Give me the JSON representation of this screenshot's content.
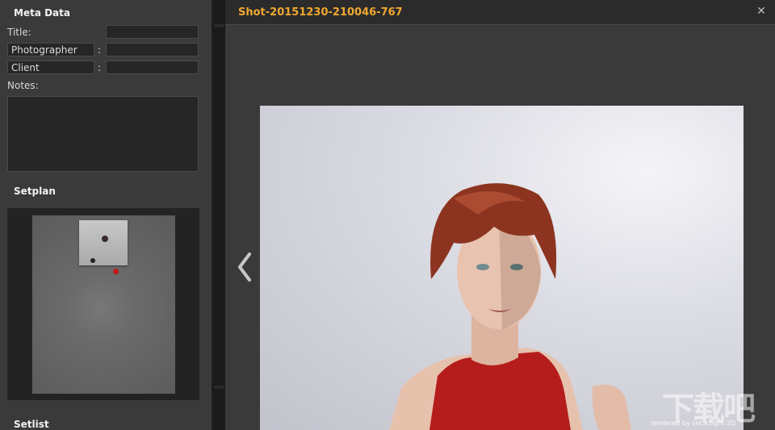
{
  "meta_panel": {
    "title": "Meta Data",
    "title_label": "Title:",
    "title_value": "",
    "photographer_label": "Photographer",
    "photographer_value": "",
    "client_label": "Client",
    "client_value": "",
    "colon": ":",
    "notes_label": "Notes:",
    "notes_value": ""
  },
  "setplan": {
    "title": "Setplan"
  },
  "setlist": {
    "title": "Setlist"
  },
  "viewer": {
    "shot_title": "Shot-20151230-210046-767",
    "close_icon": "close-icon",
    "prev_icon": "chevron-left-icon",
    "credit_text": "rendered by set.a.light 3D",
    "accent_color": "#f0a830"
  },
  "watermark": {
    "text": "下载吧"
  }
}
